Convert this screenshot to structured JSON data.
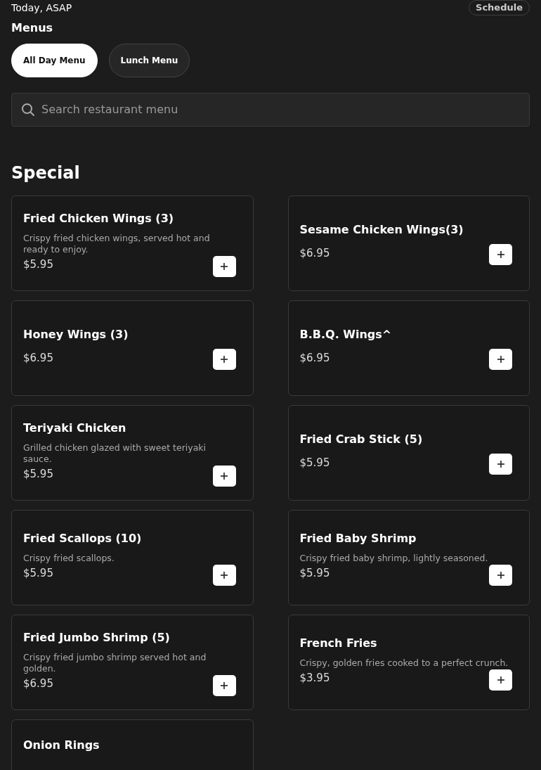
{
  "delivery": {
    "time": "Today, ASAP",
    "schedule_button": "Schedule"
  },
  "menus": {
    "heading": "Menus",
    "tabs": [
      {
        "label": "All Day Menu",
        "selected": true
      },
      {
        "label": "Lunch Menu",
        "selected": false
      }
    ]
  },
  "search": {
    "placeholder": "Search restaurant menu"
  },
  "section": {
    "title": "Special",
    "items": [
      {
        "name": "Fried Chicken Wings (3)",
        "description": "Crispy fried chicken wings, served hot and ready to enjoy.",
        "price": "$5.95"
      },
      {
        "name": "Sesame Chicken Wings(3)",
        "price": "$6.95"
      },
      {
        "name": "Honey Wings (3)",
        "price": "$6.95"
      },
      {
        "name": "B.B.Q. Wings^",
        "price": "$6.95"
      },
      {
        "name": "Teriyaki Chicken",
        "description": "Grilled chicken glazed with sweet teriyaki sauce.",
        "price": "$5.95"
      },
      {
        "name": "Fried Crab Stick (5)",
        "price": "$5.95"
      },
      {
        "name": "Fried Scallops (10)",
        "description": "Crispy fried scallops.",
        "price": "$5.95"
      },
      {
        "name": "Fried Baby Shrimp",
        "description": "Crispy fried baby shrimp, lightly seasoned.",
        "price": "$5.95"
      },
      {
        "name": "Fried Jumbo Shrimp (5)",
        "description": "Crispy fried jumbo shrimp served hot and golden.",
        "price": "$6.95"
      },
      {
        "name": "French Fries",
        "description": "Crispy, golden fries cooked to a perfect crunch.",
        "price": "$3.95"
      },
      {
        "name": "Onion Rings"
      }
    ]
  }
}
